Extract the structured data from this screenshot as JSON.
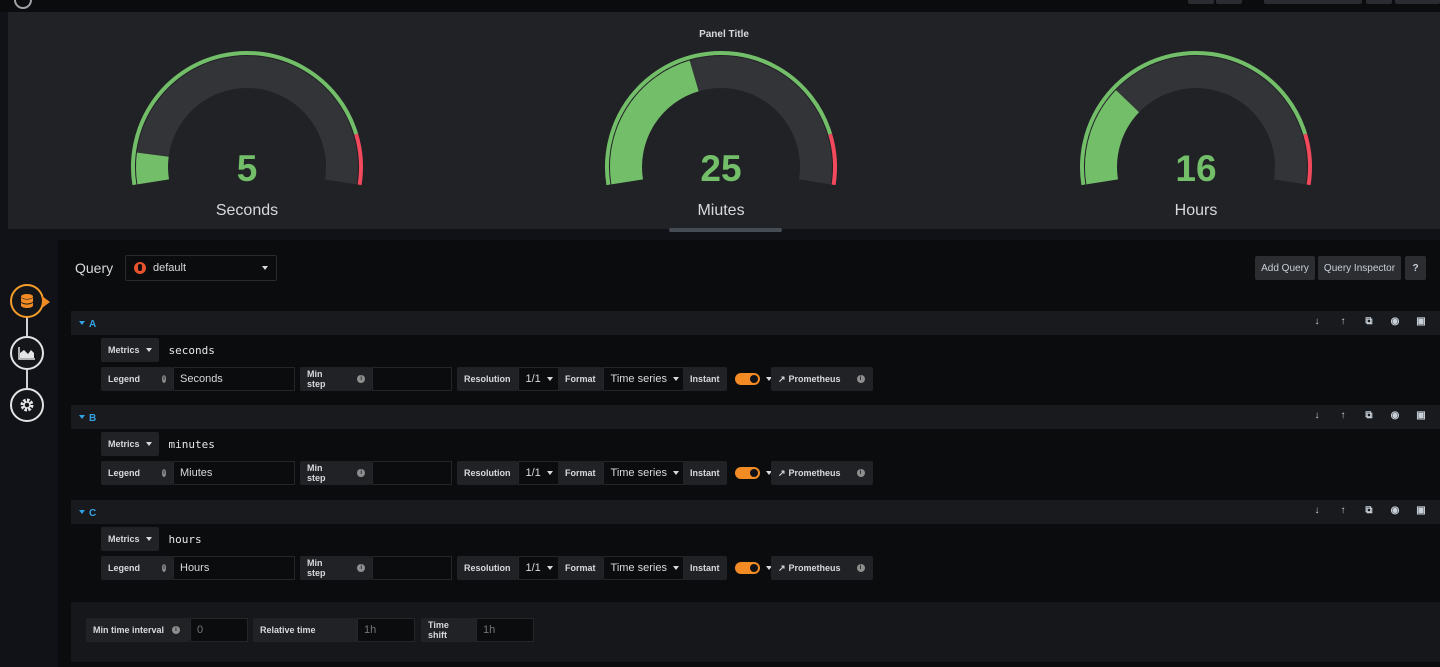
{
  "panel": {
    "title": "Panel Title",
    "gauges": [
      {
        "value": "5",
        "label": "Seconds",
        "fraction": 0.083
      },
      {
        "value": "25",
        "label": "Miutes",
        "fraction": 0.417
      },
      {
        "value": "16",
        "label": "Hours",
        "fraction": 0.267
      }
    ]
  },
  "editor": {
    "title": "Query",
    "datasource": "default",
    "add_query": "Add Query",
    "query_inspector": "Query Inspector",
    "help": "?",
    "queries": [
      {
        "letter": "A",
        "metrics_label": "Metrics",
        "expr": "seconds",
        "legend_label": "Legend",
        "legend": "Seconds",
        "minstep_label": "Min step",
        "minstep": "",
        "resolution_label": "Resolution",
        "resolution": "1/1",
        "format_label": "Format",
        "format": "Time series",
        "instant_label": "Instant",
        "link": "Prometheus"
      },
      {
        "letter": "B",
        "metrics_label": "Metrics",
        "expr": "minutes",
        "legend_label": "Legend",
        "legend": "Miutes",
        "minstep_label": "Min step",
        "minstep": "",
        "resolution_label": "Resolution",
        "resolution": "1/1",
        "format_label": "Format",
        "format": "Time series",
        "instant_label": "Instant",
        "link": "Prometheus"
      },
      {
        "letter": "C",
        "metrics_label": "Metrics",
        "expr": "hours",
        "legend_label": "Legend",
        "legend": "Hours",
        "minstep_label": "Min step",
        "minstep": "",
        "resolution_label": "Resolution",
        "resolution": "1/1",
        "format_label": "Format",
        "format": "Time series",
        "instant_label": "Instant",
        "link": "Prometheus"
      }
    ],
    "options": {
      "min_interval_label": "Min time interval",
      "min_interval_placeholder": "0",
      "relative_label": "Relative time",
      "relative_placeholder": "1h",
      "shift_label": "Time shift",
      "shift_placeholder": "1h"
    }
  },
  "colors": {
    "green": "#73bf69",
    "red": "#f2495c",
    "orange": "#f38b25",
    "blue": "#33a2e5"
  }
}
